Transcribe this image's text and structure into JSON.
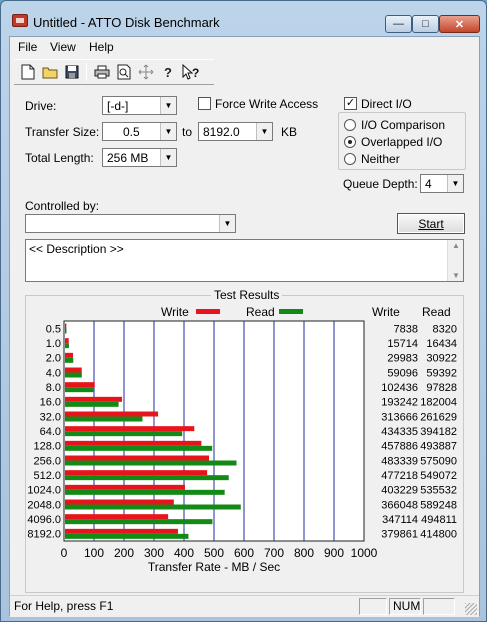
{
  "window": {
    "title": "Untitled - ATTO Disk Benchmark",
    "minimize_glyph": "—",
    "maximize_glyph": "□",
    "close_glyph": "✕"
  },
  "menu": [
    "File",
    "View",
    "Help"
  ],
  "toolbar": {
    "icons": [
      "new-file-icon",
      "open-folder-icon",
      "save-icon",
      "print-icon",
      "print-preview-icon",
      "move-icon",
      "help-icon",
      "context-help-icon"
    ]
  },
  "form": {
    "drive_label": "Drive:",
    "drive_value": "[-d-]",
    "force_write_label": "Force Write Access",
    "force_write_checked": false,
    "direct_io_label": "Direct I/O",
    "direct_io_checked": true,
    "transfer_size_label": "Transfer Size:",
    "transfer_from": "0.5",
    "to_label": "to",
    "transfer_to": "8192.0",
    "kb_label": "KB",
    "total_length_label": "Total Length:",
    "total_length_value": "256 MB",
    "io_comparison_label": "I/O Comparison",
    "overlapped_io_label": "Overlapped I/O",
    "neither_label": "Neither",
    "selected_mode": "Overlapped I/O",
    "queue_depth_label": "Queue Depth:",
    "queue_depth_value": "4",
    "controlled_by_label": "Controlled by:",
    "controlled_by_value": "",
    "start_label": "Start",
    "description_text": "<< Description >>"
  },
  "results": {
    "title": "Test Results",
    "write_legend": "Write",
    "read_legend": "Read",
    "write_header": "Write",
    "read_header": "Read",
    "write_color": "#e8141c",
    "read_color": "#138a16"
  },
  "chart_data": {
    "type": "bar",
    "orientation": "horizontal",
    "title": "Test Results",
    "xlabel": "Transfer Rate - MB / Sec",
    "xlim": [
      0,
      1000
    ],
    "x_ticks": [
      0,
      100,
      200,
      300,
      400,
      500,
      600,
      700,
      800,
      900,
      1000
    ],
    "categories": [
      "0.5",
      "1.0",
      "2.0",
      "4.0",
      "8.0",
      "16.0",
      "32.0",
      "64.0",
      "128.0",
      "256.0",
      "512.0",
      "1024.0",
      "2048.0",
      "4096.0",
      "8192.0"
    ],
    "series": [
      {
        "name": "Write",
        "values": [
          7838,
          15714,
          29983,
          59096,
          102436,
          193242,
          313666,
          434335,
          457886,
          483339,
          477218,
          403229,
          366048,
          347114,
          379861
        ],
        "display_scale": 1000
      },
      {
        "name": "Read",
        "values": [
          8320,
          16434,
          30922,
          59392,
          97828,
          182004,
          261629,
          394182,
          493887,
          575090,
          549072,
          535532,
          589248,
          494811,
          414800
        ],
        "display_scale": 1000
      }
    ],
    "grid": true,
    "legend": "top"
  },
  "status": {
    "help_text": "For Help, press F1",
    "num_indicator": "NUM"
  }
}
